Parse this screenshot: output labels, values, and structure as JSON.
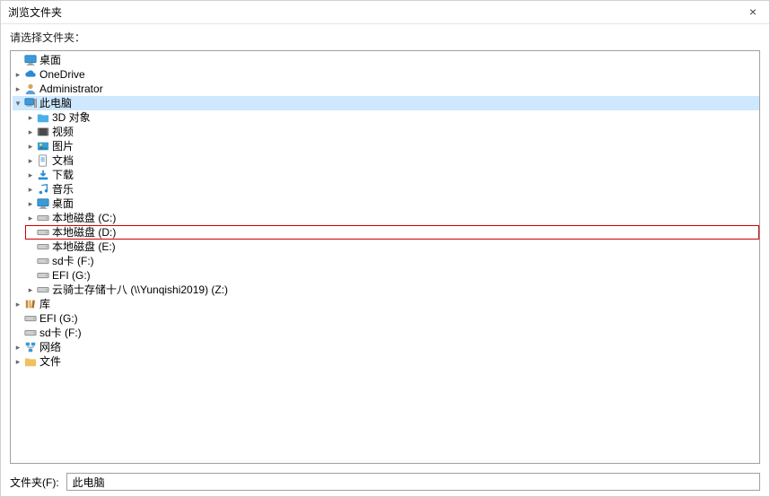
{
  "window": {
    "title": "浏览文件夹",
    "prompt": "请选择文件夹："
  },
  "footer": {
    "label": "文件夹(F):",
    "value": "此电脑"
  },
  "icons": {
    "desktop": "desktop",
    "onedrive": "cloud",
    "user": "user",
    "pc": "pc",
    "folder3d": "folder-sys",
    "video": "video",
    "pictures": "pictures",
    "documents": "documents",
    "downloads": "downloads",
    "music": "music",
    "desk2": "desktop",
    "drive": "drive",
    "sd": "drive",
    "efi": "drive",
    "netloc": "drive",
    "libs": "library",
    "network": "network",
    "folder": "folder"
  },
  "tree": [
    {
      "id": "desktop",
      "label": "桌面",
      "icon": "desktop",
      "expander": "none",
      "children": []
    },
    {
      "id": "onedrive",
      "label": "OneDrive",
      "icon": "onedrive",
      "expander": "closed"
    },
    {
      "id": "admin",
      "label": "Administrator",
      "icon": "user",
      "expander": "closed"
    },
    {
      "id": "thispc",
      "label": "此电脑",
      "icon": "pc",
      "expander": "open",
      "selected": true,
      "children": [
        {
          "id": "3d",
          "label": "3D 对象",
          "icon": "folder3d",
          "expander": "closed"
        },
        {
          "id": "video",
          "label": "视频",
          "icon": "video",
          "expander": "closed"
        },
        {
          "id": "pictures",
          "label": "图片",
          "icon": "pictures",
          "expander": "closed"
        },
        {
          "id": "documents",
          "label": "文档",
          "icon": "documents",
          "expander": "closed"
        },
        {
          "id": "downloads",
          "label": "下载",
          "icon": "downloads",
          "expander": "closed"
        },
        {
          "id": "music",
          "label": "音乐",
          "icon": "music",
          "expander": "closed"
        },
        {
          "id": "desk2",
          "label": "桌面",
          "icon": "desk2",
          "expander": "closed"
        },
        {
          "id": "drivec",
          "label": "本地磁盘 (C:)",
          "icon": "drive",
          "expander": "closed"
        },
        {
          "id": "drived",
          "label": "本地磁盘 (D:)",
          "icon": "drive",
          "expander": "none",
          "highlight": true
        },
        {
          "id": "drivee",
          "label": "本地磁盘 (E:)",
          "icon": "drive",
          "expander": "none"
        },
        {
          "id": "sdf",
          "label": "sd卡 (F:)",
          "icon": "sd",
          "expander": "none"
        },
        {
          "id": "efig",
          "label": "EFI (G:)",
          "icon": "efi",
          "expander": "none"
        },
        {
          "id": "netz",
          "label": "云骑士存储十八 (\\\\Yunqishi2019) (Z:)",
          "icon": "netloc",
          "expander": "closed"
        }
      ]
    },
    {
      "id": "libs",
      "label": "库",
      "icon": "libs",
      "expander": "closed"
    },
    {
      "id": "efig2",
      "label": "EFI (G:)",
      "icon": "efi",
      "expander": "none"
    },
    {
      "id": "sdf2",
      "label": "sd卡 (F:)",
      "icon": "sd",
      "expander": "none"
    },
    {
      "id": "network",
      "label": "网络",
      "icon": "network",
      "expander": "closed"
    },
    {
      "id": "files",
      "label": "文件",
      "icon": "folder",
      "expander": "closed"
    }
  ]
}
